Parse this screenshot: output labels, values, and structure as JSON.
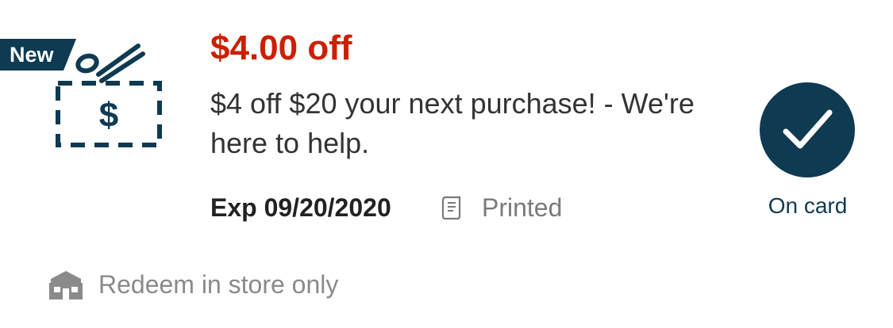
{
  "coupon": {
    "badge": "New",
    "offer_amount": "$4.00 off",
    "description": "$4 off $20 your next purchase! - We're here to help.",
    "expiration": "Exp 09/20/2020",
    "print_status": "Printed",
    "clip_status": "On card",
    "redeem_note": "Redeem in store only"
  },
  "icons": {
    "coupon": "coupon-scissors-dollar-icon",
    "receipt": "receipt-icon",
    "check": "checkmark-icon",
    "store": "store-icon"
  },
  "colors": {
    "offer_red": "#cc1f00",
    "brand_navy": "#0e3a52",
    "muted_gray": "#8a8a8a",
    "text_dark": "#333333"
  }
}
